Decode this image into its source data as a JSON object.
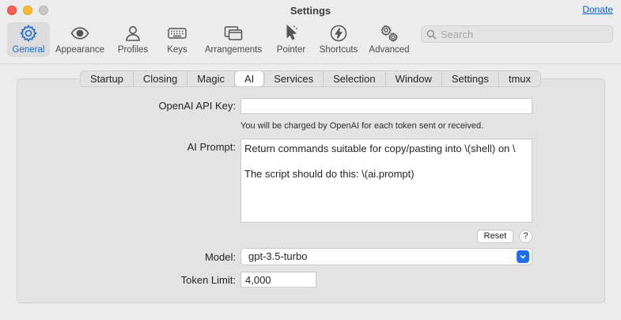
{
  "window": {
    "title": "Settings",
    "donate_label": "Donate"
  },
  "toolbar": {
    "items": [
      {
        "label": "General",
        "icon": "gear-icon",
        "selected": true
      },
      {
        "label": "Appearance",
        "icon": "eye-icon",
        "selected": false
      },
      {
        "label": "Profiles",
        "icon": "person-icon",
        "selected": false
      },
      {
        "label": "Keys",
        "icon": "keyboard-icon",
        "selected": false
      },
      {
        "label": "Arrangements",
        "icon": "windows-icon",
        "selected": false
      },
      {
        "label": "Pointer",
        "icon": "pointer-icon",
        "selected": false
      },
      {
        "label": "Shortcuts",
        "icon": "bolt-icon",
        "selected": false
      },
      {
        "label": "Advanced",
        "icon": "gears-icon",
        "selected": false
      }
    ],
    "search": {
      "placeholder": "Search",
      "value": ""
    }
  },
  "tabs": [
    {
      "label": "Startup",
      "active": false
    },
    {
      "label": "Closing",
      "active": false
    },
    {
      "label": "Magic",
      "active": false
    },
    {
      "label": "AI",
      "active": true
    },
    {
      "label": "Services",
      "active": false
    },
    {
      "label": "Selection",
      "active": false
    },
    {
      "label": "Window",
      "active": false
    },
    {
      "label": "Settings",
      "active": false
    },
    {
      "label": "tmux",
      "active": false
    }
  ],
  "form": {
    "api_key_label": "OpenAI API Key:",
    "api_key_value": "",
    "api_key_note": "You will be charged by OpenAI for each token sent or received.",
    "prompt_label": "AI Prompt:",
    "prompt_line1": "Return commands suitable for copy/pasting into \\(shell) on \\",
    "prompt_line2": "The script should do this: \\(ai.prompt)",
    "reset_label": "Reset",
    "help_label": "?",
    "model_label": "Model:",
    "model_value": "gpt-3.5-turbo",
    "token_limit_label": "Token Limit:",
    "token_limit_value": "4,000"
  },
  "colors": {
    "accent": "#1e6bd6",
    "close": "#fe5f57",
    "minimize": "#febc2e",
    "maximize": "#c8c8c8"
  }
}
